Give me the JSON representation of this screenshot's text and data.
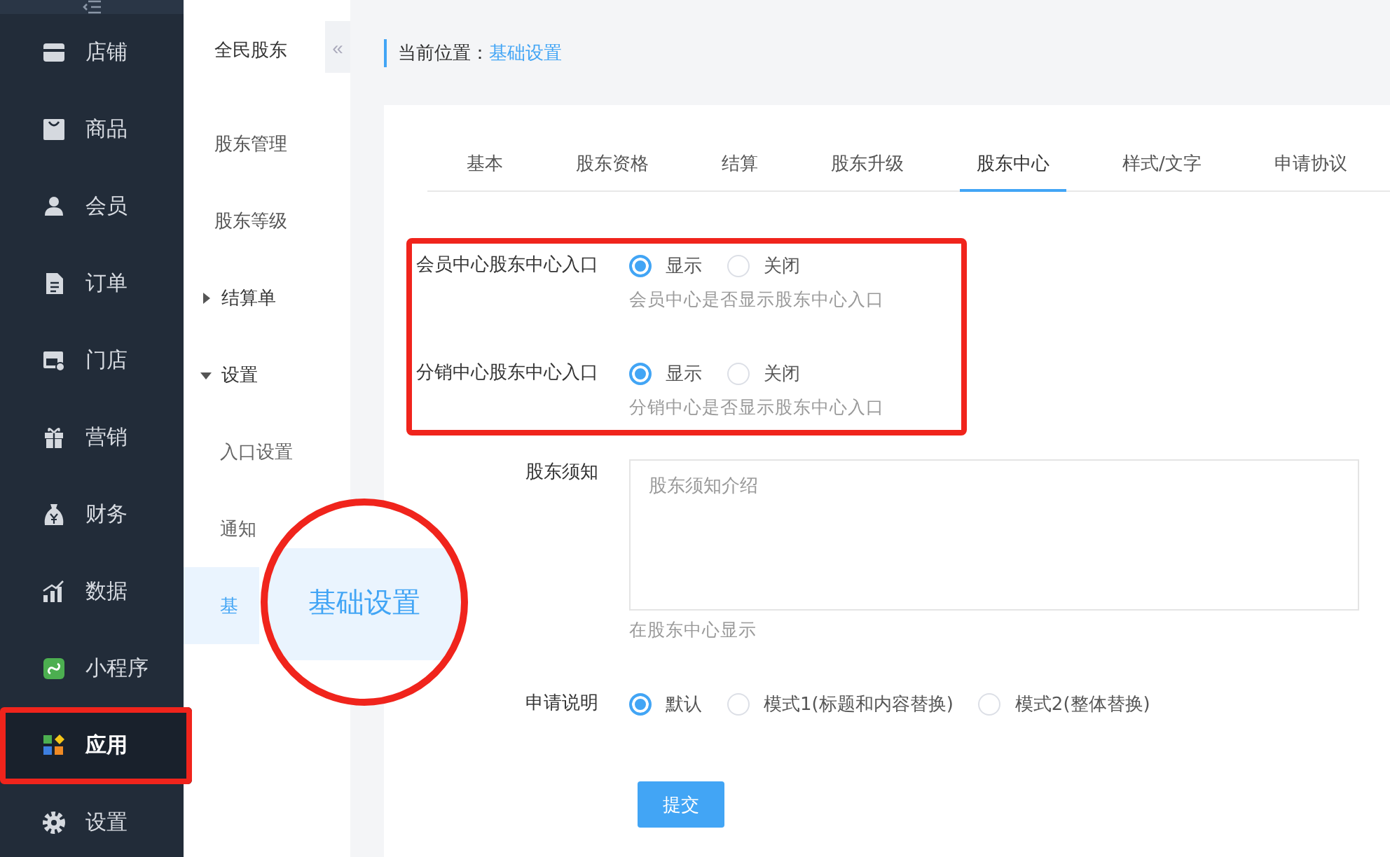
{
  "nav": {
    "items": [
      {
        "kind": "store",
        "label": "店铺",
        "selected": false,
        "annotated": false
      },
      {
        "kind": "bag",
        "label": "商品",
        "selected": false,
        "annotated": false
      },
      {
        "kind": "user",
        "label": "会员",
        "selected": false,
        "annotated": false
      },
      {
        "kind": "doc",
        "label": "订单",
        "selected": false,
        "annotated": false
      },
      {
        "kind": "shop",
        "label": "门店",
        "selected": false,
        "annotated": false
      },
      {
        "kind": "gift",
        "label": "营销",
        "selected": false,
        "annotated": false
      },
      {
        "kind": "money",
        "label": "财务",
        "selected": false,
        "annotated": false
      },
      {
        "kind": "chart",
        "label": "数据",
        "selected": false,
        "annotated": false
      },
      {
        "kind": "mini",
        "label": "小程序",
        "selected": false,
        "annotated": false
      },
      {
        "kind": "apps",
        "label": "应用",
        "selected": true,
        "annotated": true
      },
      {
        "kind": "gear",
        "label": "设置",
        "selected": false,
        "annotated": false
      }
    ]
  },
  "submenu": {
    "title": "全民股东",
    "collapse_glyph": "«",
    "items": [
      {
        "label": "股东管理",
        "selected": false
      },
      {
        "label": "股东等级",
        "selected": false
      },
      {
        "label": "结算单",
        "expanded": false,
        "selected": false
      },
      {
        "label": "设置",
        "expanded": true,
        "selected": false,
        "children": [
          {
            "label": "入口设置",
            "selected": false
          },
          {
            "label": "通知",
            "selected": false
          },
          {
            "label": "基",
            "selected": true
          }
        ]
      }
    ]
  },
  "magnifier": {
    "text": "基础设置"
  },
  "breadcrumb": {
    "prefix": "当前位置：",
    "current": "基础设置"
  },
  "tabs": [
    {
      "label": "基本",
      "selected": false
    },
    {
      "label": "股东资格",
      "selected": false
    },
    {
      "label": "结算",
      "selected": false
    },
    {
      "label": "股东升级",
      "selected": false
    },
    {
      "label": "股东中心",
      "selected": true
    },
    {
      "label": "样式/文字",
      "selected": false
    },
    {
      "label": "申请协议",
      "selected": false
    }
  ],
  "entry_group": {
    "annotated": true,
    "rows": [
      {
        "label": "会员中心股东中心入口",
        "options": [
          {
            "label": "显示",
            "selected": true
          },
          {
            "label": "关闭",
            "selected": false
          }
        ],
        "help": "会员中心是否显示股东中心入口"
      },
      {
        "label": "分销中心股东中心入口",
        "options": [
          {
            "label": "显示",
            "selected": true
          },
          {
            "label": "关闭",
            "selected": false
          }
        ],
        "help": "分销中心是否显示股东中心入口"
      }
    ]
  },
  "notice": {
    "label": "股东须知",
    "placeholder": "股东须知介绍",
    "help": "在股东中心显示"
  },
  "apply": {
    "label": "申请说明",
    "options": [
      {
        "label": "默认",
        "selected": true
      },
      {
        "label": "模式1(标题和内容替换)",
        "selected": false
      },
      {
        "label": "模式2(整体替换)",
        "selected": false
      }
    ]
  },
  "submit": "提交"
}
